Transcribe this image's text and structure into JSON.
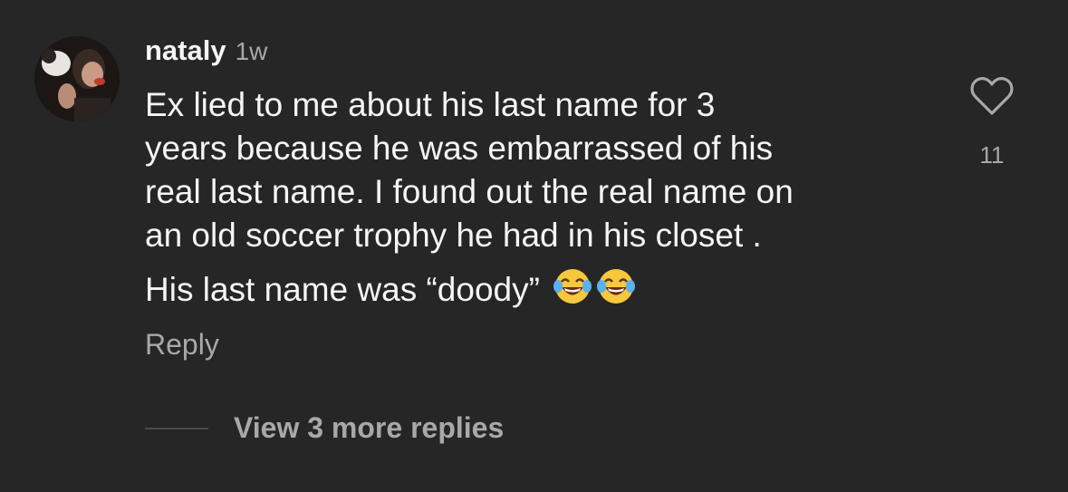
{
  "comment": {
    "username": "nataly",
    "timestamp": "1w",
    "body_lines": [
      "Ex lied to me about his last name for 3",
      "years because he was embarrassed of his",
      "real last name. I found out the real name on",
      "an old soccer trophy he had in his closet .",
      "His last name was “doody”"
    ],
    "emojis": [
      "face-with-tears-of-joy",
      "face-with-tears-of-joy"
    ],
    "reply_label": "Reply",
    "like_count": "11",
    "like_icon": "heart-outline-icon",
    "view_replies_label": "View 3 more replies"
  },
  "colors": {
    "background": "#262626",
    "primary_text": "#f5f5f5",
    "secondary_text": "#a8a8a8"
  }
}
